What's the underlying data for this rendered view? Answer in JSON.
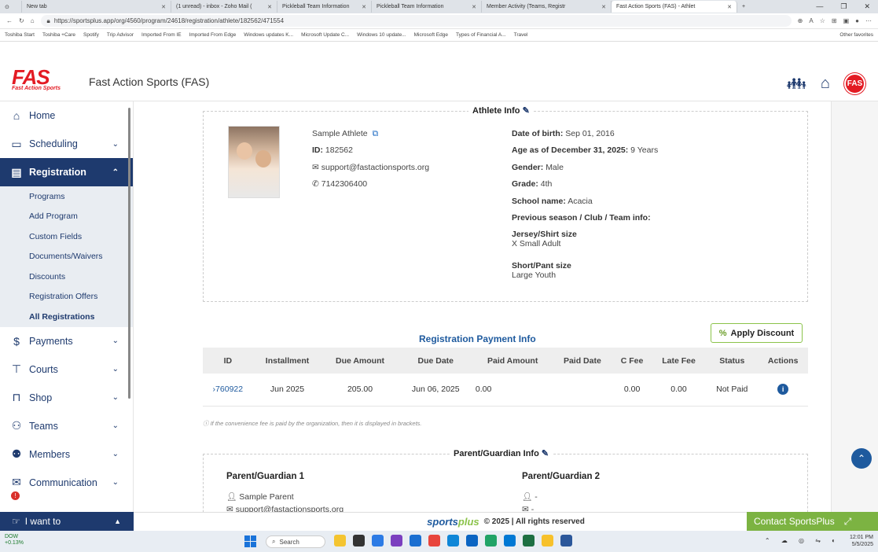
{
  "browser": {
    "tabs": [
      {
        "title": "New tab"
      },
      {
        "title": "(1 unread) - inbox - Zoho Mail ("
      },
      {
        "title": "Pickleball Team Information"
      },
      {
        "title": "Pickleball Team Information"
      },
      {
        "title": "Member Activity (Teams, Registr"
      },
      {
        "title": "Fast Action Sports (FAS) - Athlet"
      }
    ],
    "new_tab": "+",
    "url": "https://sportsplus.app/org/4560/program/24618/registration/athlete/182562/471554",
    "favorites": [
      "Toshiba Start",
      "Toshiba +Care",
      "Spotify",
      "Trip Advisor",
      "Imported From IE",
      "Imported From Edge",
      "Windows updates K...",
      "Microsoft Update C...",
      "Windows 10 update...",
      "Microsoft Edge",
      "Types of Financial A...",
      "Travel"
    ],
    "other_favorites": "Other favorites"
  },
  "header": {
    "logo_text": "FAS",
    "logo_sub": "Fast Action Sports",
    "org_name": "Fast Action Sports (FAS)",
    "badge_text": "FAS"
  },
  "sidebar": {
    "items": [
      {
        "label": "Home",
        "icon": "home-icon",
        "glyph": "⌂"
      },
      {
        "label": "Scheduling",
        "icon": "calendar-icon",
        "glyph": "▭"
      },
      {
        "label": "Registration",
        "icon": "registration-icon",
        "glyph": "▤"
      },
      {
        "label": "Payments",
        "icon": "dollar-icon",
        "glyph": "$"
      },
      {
        "label": "Courts",
        "icon": "court-icon",
        "glyph": "⊤"
      },
      {
        "label": "Shop",
        "icon": "cart-icon",
        "glyph": "⊓"
      },
      {
        "label": "Teams",
        "icon": "teams-icon",
        "glyph": "⚇"
      },
      {
        "label": "Members",
        "icon": "members-icon",
        "glyph": "⚉"
      },
      {
        "label": "Communication",
        "icon": "envelope-icon",
        "glyph": "✉"
      }
    ],
    "registration_sub": [
      "Programs",
      "Add Program",
      "Custom Fields",
      "Documents/Waivers",
      "Discounts",
      "Registration Offers",
      "All Registrations"
    ],
    "alert_count": "!",
    "i_want_to": "I want to"
  },
  "athlete": {
    "section_title": "Athlete Info",
    "name": "Sample Athlete",
    "id_label": "ID:",
    "id_value": "182562",
    "email": "support@fastactionsports.org",
    "phone": "7142306400",
    "dob_label": "Date of birth:",
    "dob_value": "Sep 01, 2016",
    "age_label": "Age as of December 31, 2025:",
    "age_value": "9 Years",
    "gender_label": "Gender:",
    "gender_value": "Male",
    "grade_label": "Grade:",
    "grade_value": "4th",
    "school_label": "School name:",
    "school_value": "Acacia",
    "prev_label": "Previous season / Club / Team info:",
    "jersey_label": "Jersey/Shirt size",
    "jersey_value": "X Small Adult",
    "short_label": "Short/Pant size",
    "short_value": "Large Youth"
  },
  "payment": {
    "title": "Registration Payment Info",
    "apply_discount": "Apply Discount",
    "columns": [
      "ID",
      "Installment",
      "Due Amount",
      "Due Date",
      "Paid Amount",
      "Paid Date",
      "C Fee",
      "Late Fee",
      "Status",
      "Actions"
    ],
    "rows": [
      {
        "id": "760922",
        "installment": "Jun 2025",
        "due_amount": "205.00",
        "due_date": "Jun 06, 2025",
        "paid_amount": "0.00",
        "paid_date": "",
        "c_fee": "0.00",
        "late_fee": "0.00",
        "status": "Not Paid"
      }
    ],
    "note": "If the convenience fee is paid by the organization, then it is displayed in brackets."
  },
  "guardian": {
    "section_title": "Parent/Guardian Info",
    "g1_title": "Parent/Guardian 1",
    "g1_name": "Sample Parent",
    "g1_email": "support@fastactionsports.org",
    "g2_title": "Parent/Guardian 2",
    "g2_name": "-",
    "g2_email": "-"
  },
  "footer": {
    "brand_a": "sports",
    "brand_b": "plus",
    "copyright": "© 2025 | All rights reserved",
    "contact": "Contact SportsPlus"
  },
  "taskbar": {
    "weather_label": "DOW",
    "weather_value": "+0.13%",
    "search": "Search",
    "time": "12:01 PM",
    "date": "5/5/2025"
  }
}
